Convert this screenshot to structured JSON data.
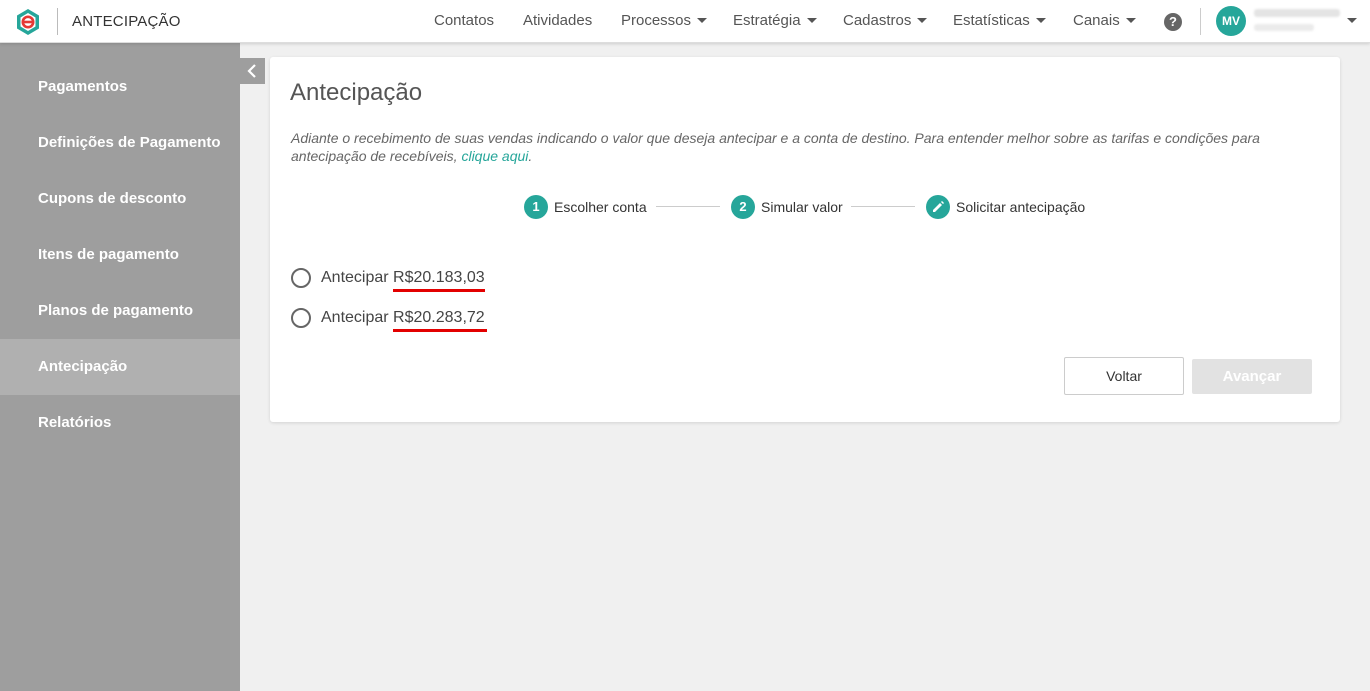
{
  "header": {
    "app_title": "ANTECIPAÇÃO",
    "nav": [
      "Contatos",
      "Atividades",
      "Processos",
      "Estratégia",
      "Cadastros",
      "Estatísticas",
      "Canais"
    ],
    "help_label": "?",
    "avatar_initials": "MV"
  },
  "sidebar": {
    "items": [
      {
        "label": "Pagamentos"
      },
      {
        "label": "Definições de Pagamento"
      },
      {
        "label": "Cupons de desconto"
      },
      {
        "label": "Itens de pagamento"
      },
      {
        "label": "Planos de pagamento"
      },
      {
        "label": "Antecipação"
      },
      {
        "label": "Relatórios"
      }
    ],
    "active_item": "Antecipação"
  },
  "main": {
    "title": "Antecipação",
    "description": "Adiante o recebimento de suas vendas indicando o valor que deseja antecipar e a conta de destino. Para entender melhor sobre as tarifas e condições para antecipação de recebíveis,",
    "description_link": "clique aqui",
    "description_end": ".",
    "steps": [
      {
        "number": "1",
        "label": "Escolher conta"
      },
      {
        "number": "2",
        "label": "Simular valor"
      },
      {
        "icon": "pencil-icon",
        "label": "Solicitar antecipação"
      }
    ],
    "options": [
      {
        "prefix": "Antecipar",
        "amount": "R$20.183,03"
      },
      {
        "prefix": "Antecipar",
        "amount": "R$20.283,72"
      }
    ],
    "back_label": "Voltar",
    "next_label": "Avançar"
  },
  "colors": {
    "accent": "#26a69a",
    "sidebar_bg": "#9e9e9e",
    "highlight_underline": "#e30000"
  }
}
